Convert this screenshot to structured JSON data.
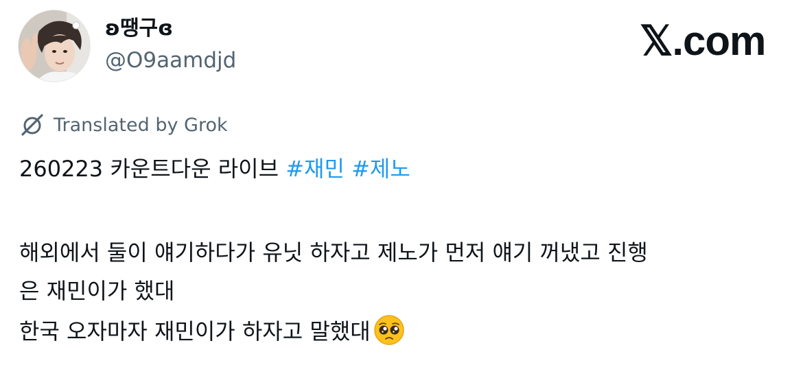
{
  "user": {
    "display_name": "ʚ땡구ɞ",
    "handle": "@O9aamdjd"
  },
  "brand": {
    "label": "𝕏.com"
  },
  "translation": {
    "label": "Translated by Grok",
    "icon": "grok-icon"
  },
  "tweet": {
    "line1_text": "260223 카운트다운 라이브 ",
    "hashtags": [
      "#재민",
      "#제노"
    ],
    "line2": "해외에서 둘이 얘기하다가 유닛 하자고 제노가 먼저 얘기 꺼냈고 진행",
    "line3": "은 재민이가 했대",
    "line4": "한국 오자마자 재민이가 하자고 말했대",
    "emoji": "pleading-face-emoji"
  },
  "colors": {
    "text": "#0f1419",
    "secondary": "#536471",
    "link": "#1d9bf0"
  }
}
